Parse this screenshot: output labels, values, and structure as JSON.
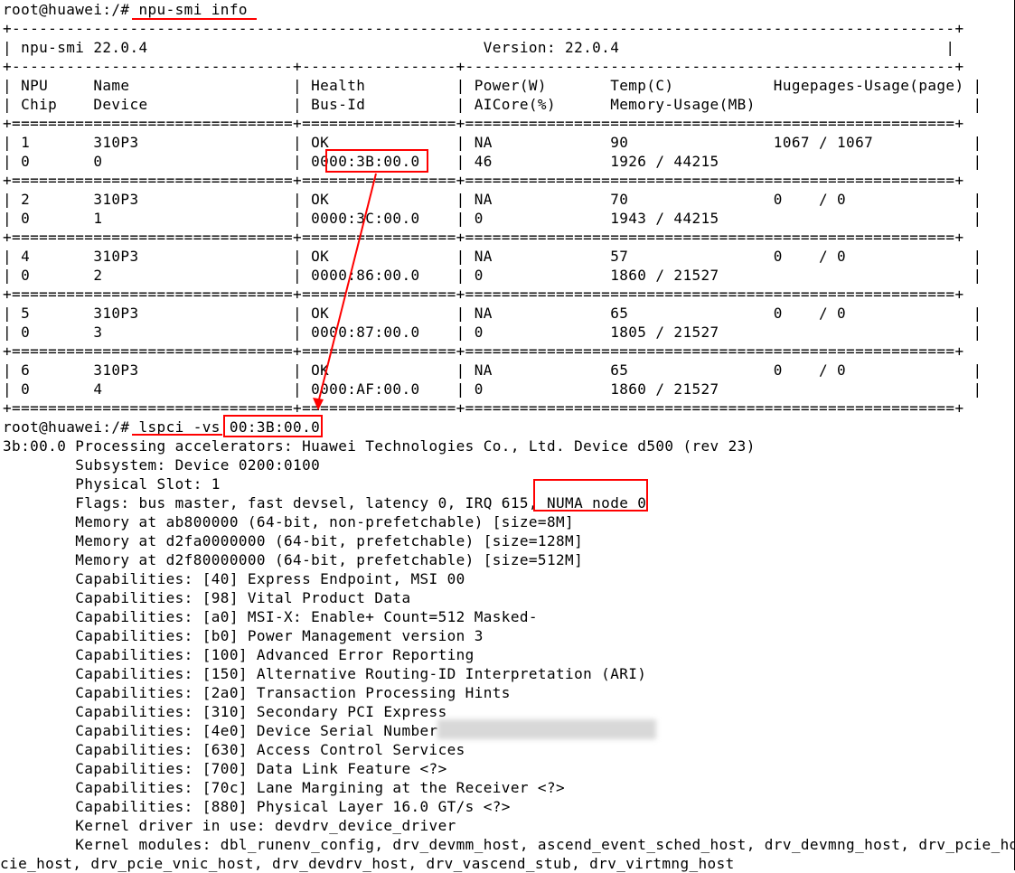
{
  "terminal": {
    "lines": [
      "root@huawei:/# npu-smi info",
      "+--------------------------------------------------------------------------------------------------------+",
      "| npu-smi 22.0.4                                     Version: 22.0.4                                    |",
      "+-------------------------------+-----------------+------------------------------------------------------+",
      "| NPU     Name                  | Health          | Power(W)       Temp(C)           Hugepages-Usage(page) |",
      "| Chip    Device                | Bus-Id          | AICore(%)      Memory-Usage(MB)                        |",
      "+===============================+=================+======================================================+",
      "| 1       310P3                 | OK              | NA             90                1067 / 1067           |",
      "| 0       0                     | 0000:3B:00.0    | 46             1926 / 44215                            |",
      "+===============================+=================+======================================================+",
      "| 2       310P3                 | OK              | NA             70                0    / 0              |",
      "| 0       1                     | 0000:3C:00.0    | 0              1943 / 44215                            |",
      "+===============================+=================+======================================================+",
      "| 4       310P3                 | OK              | NA             57                0    / 0              |",
      "| 0       2                     | 0000:86:00.0    | 0              1860 / 21527                            |",
      "+===============================+=================+======================================================+",
      "| 5       310P3                 | OK              | NA             65                0    / 0              |",
      "| 0       3                     | 0000:87:00.0    | 0              1805 / 21527                            |",
      "+===============================+=================+======================================================+",
      "| 6       310P3                 | OK              | NA             65                0    / 0              |",
      "| 0       4                     | 0000:AF:00.0    | 0              1860 / 21527                            |",
      "+===============================+=================+======================================================+",
      "root@huawei:/# lspci -vs 00:3B:00.0",
      "3b:00.0 Processing accelerators: Huawei Technologies Co., Ltd. Device d500 (rev 23)",
      "        Subsystem: Device 0200:0100",
      "        Physical Slot: 1",
      "        Flags: bus master, fast devsel, latency 0, IRQ 615, NUMA node 0",
      "        Memory at ab800000 (64-bit, non-prefetchable) [size=8M]",
      "        Memory at d2fa0000000 (64-bit, prefetchable) [size=128M]",
      "        Memory at d2f80000000 (64-bit, prefetchable) [size=512M]",
      "        Capabilities: [40] Express Endpoint, MSI 00",
      "        Capabilities: [98] Vital Product Data",
      "        Capabilities: [a0] MSI-X: Enable+ Count=512 Masked-",
      "        Capabilities: [b0] Power Management version 3",
      "        Capabilities: [100] Advanced Error Reporting",
      "        Capabilities: [150] Alternative Routing-ID Interpretation (ARI)",
      "        Capabilities: [2a0] Transaction Processing Hints",
      "        Capabilities: [310] Secondary PCI Express",
      "        Capabilities: [4e0] Device Serial Number",
      "        Capabilities: [630] Access Control Services",
      "        Capabilities: [700] Data Link Feature <?>",
      "        Capabilities: [70c] Lane Margining at the Receiver <?>",
      "        Capabilities: [880] Physical Layer 16.0 GT/s <?>",
      "        Kernel driver in use: devdrv_device_driver",
      "        Kernel modules: dbl_runenv_config, drv_devmm_host, ascend_event_sched_host, drv_devmng_host, drv_pcie_hdc",
      "cie_host, drv_pcie_vnic_host, drv_devdrv_host, drv_vascend_stub, drv_virtmng_host"
    ]
  },
  "colors": {
    "background": "#ffffff",
    "text": "#000000",
    "annotation": "#ff0000"
  }
}
